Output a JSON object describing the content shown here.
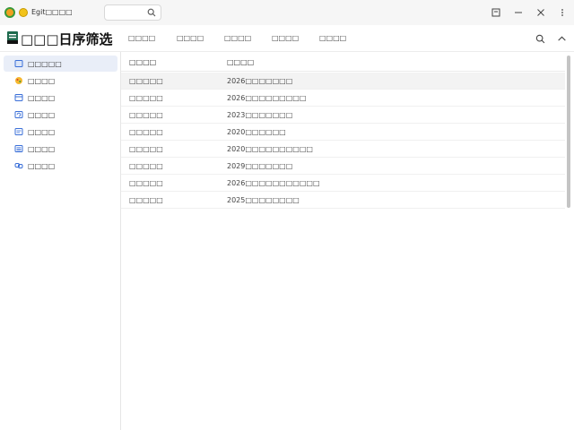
{
  "titlebar": {
    "app_title": "Egit□□□□",
    "search_value": ""
  },
  "header": {
    "page_title": "□□□日序筛选",
    "tabs": [
      {
        "label": "□□□□"
      },
      {
        "label": "□□□□"
      },
      {
        "label": "□□□□"
      },
      {
        "label": "□□□□"
      },
      {
        "label": "□□□□"
      }
    ]
  },
  "sidebar": {
    "items": [
      {
        "label": "□□□□□",
        "icon": "square-icon",
        "active": true
      },
      {
        "label": "□□□□",
        "icon": "palette-icon",
        "active": false
      },
      {
        "label": "□□□□",
        "icon": "window-icon",
        "active": false
      },
      {
        "label": "□□□□",
        "icon": "refresh-icon",
        "active": false
      },
      {
        "label": "□□□□",
        "icon": "document-icon",
        "active": false
      },
      {
        "label": "□□□□",
        "icon": "list-icon",
        "active": false
      },
      {
        "label": "□□□□",
        "icon": "link-icon",
        "active": false
      }
    ]
  },
  "list": {
    "columns": [
      "□□□□",
      "□□□□"
    ],
    "rows": [
      {
        "name": "□□□□□",
        "desc": "2026□□□□□□□",
        "selected": true
      },
      {
        "name": "□□□□□",
        "desc": "2026□□□□□□□□□",
        "selected": false
      },
      {
        "name": "□□□□□",
        "desc": "2023□□□□□□□",
        "selected": false
      },
      {
        "name": "□□□□□",
        "desc": "2020□□□□□□",
        "selected": false
      },
      {
        "name": "□□□□□",
        "desc": "2020□□□□□□□□□□",
        "selected": false
      },
      {
        "name": "□□□□□",
        "desc": "2029□□□□□□□",
        "selected": false
      },
      {
        "name": "□□□□□",
        "desc": "2026□□□□□□□□□□□",
        "selected": false
      },
      {
        "name": "□□□□□",
        "desc": "2025□□□□□□□□",
        "selected": false
      }
    ]
  },
  "colors": {
    "accent": "#3a6fd8",
    "selected_row": "#f3f3f3",
    "active_item": "#e9eef8"
  }
}
